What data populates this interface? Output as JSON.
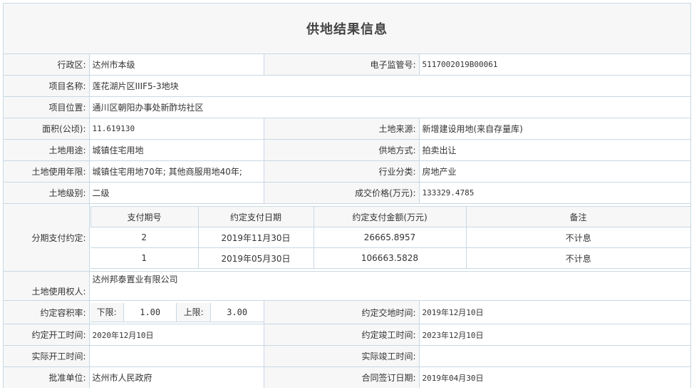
{
  "title": "供地结果信息",
  "rows": {
    "district": {
      "label": "行政区:",
      "value": "达州市本级"
    },
    "supervision_no": {
      "label": "电子监管号:",
      "value": "5117002019B00061"
    },
    "project_name": {
      "label": "项目名称:",
      "value": "莲花湖片区IIIF5-3地块"
    },
    "project_location": {
      "label": "项目位置:",
      "value": "通川区朝阳办事处新酢坊社区"
    },
    "area": {
      "label": "面积(公顷):",
      "value": "11.619130"
    },
    "land_source": {
      "label": "土地来源:",
      "value": "新增建设用地(来自存量库)"
    },
    "land_use": {
      "label": "土地用途:",
      "value": "城镇住宅用地"
    },
    "supply_method": {
      "label": "供地方式:",
      "value": "拍卖出让"
    },
    "use_term": {
      "label": "土地使用年限:",
      "value": "城镇住宅用地70年; 其他商服用地40年;"
    },
    "industry": {
      "label": "行业分类:",
      "value": "房地产业"
    },
    "land_grade": {
      "label": "土地级别:",
      "value": "二级"
    },
    "deal_price": {
      "label": "成交价格(万元):",
      "value": "133329.4785"
    },
    "installments_label": "分期支付约定:",
    "land_user": {
      "label": "土地使用权人:",
      "value": "达州邦泰置业有限公司"
    },
    "far": {
      "label": "约定容积率:",
      "lower_label": "下限:",
      "lower": "1.00",
      "upper_label": "上限:",
      "upper": "3.00"
    },
    "delivery_time": {
      "label": "约定交地时间:",
      "value": "2019年12月10日"
    },
    "start_time": {
      "label": "约定开工时间:",
      "value": "2020年12月10日"
    },
    "finish_time": {
      "label": "约定竣工时间:",
      "value": "2023年12月10日"
    },
    "actual_start": {
      "label": "实际开工时间:",
      "value": ""
    },
    "actual_finish": {
      "label": "实际竣工时间:",
      "value": ""
    },
    "approval_unit": {
      "label": "批准单位:",
      "value": "达州市人民政府"
    },
    "contract_date": {
      "label": "合同签订日期:",
      "value": "2019年04月30日"
    }
  },
  "installments": {
    "headers": [
      "支付期号",
      "约定支付日期",
      "约定支付金额(万元)",
      "备注"
    ],
    "rows": [
      [
        "2",
        "2019年11月30日",
        "26665.8957",
        "不计息"
      ],
      [
        "1",
        "2019年05月30日",
        "106663.5828",
        "不计息"
      ]
    ]
  }
}
